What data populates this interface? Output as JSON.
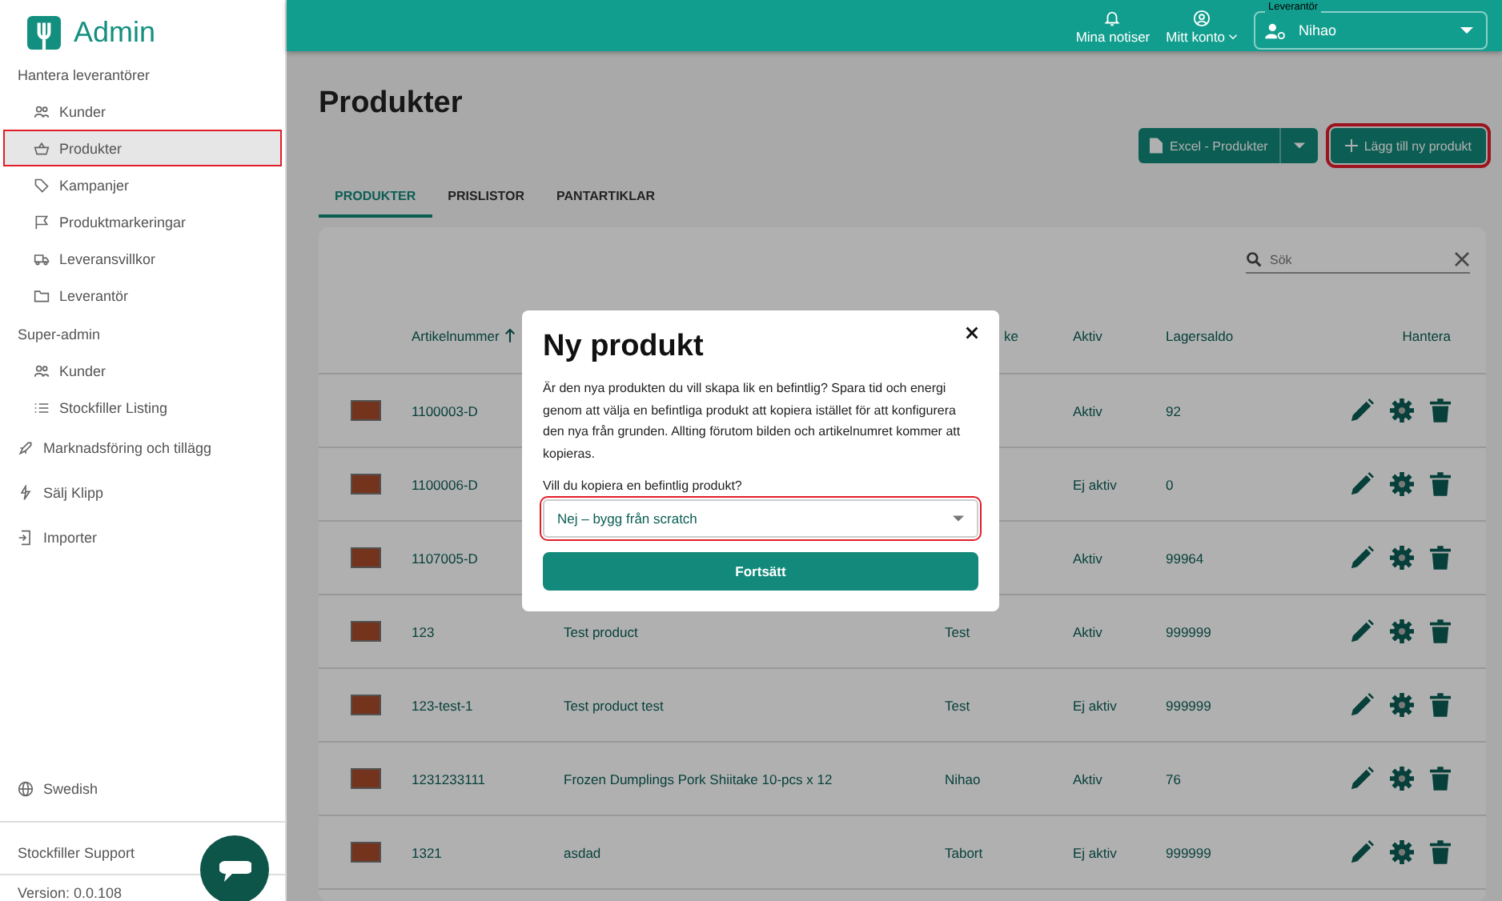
{
  "sidebar": {
    "logo": "Admin",
    "sections": [
      {
        "title": "Hantera leverantörer",
        "items": [
          {
            "label": "Kunder",
            "selected": false,
            "highlighted": false
          },
          {
            "label": "Produkter",
            "selected": true,
            "highlighted": true
          },
          {
            "label": "Kampanjer",
            "selected": false,
            "highlighted": false
          },
          {
            "label": "Produktmarkeringar",
            "selected": false,
            "highlighted": false
          },
          {
            "label": "Leveransvillkor",
            "selected": false,
            "highlighted": false
          },
          {
            "label": "Leverantör",
            "selected": false,
            "highlighted": false
          }
        ]
      },
      {
        "title": "Super-admin",
        "items": [
          {
            "label": "Kunder",
            "selected": false,
            "highlighted": false
          },
          {
            "label": "Stockfiller Listing",
            "selected": false,
            "highlighted": false
          }
        ]
      }
    ],
    "links": [
      "Marknadsföring och tillägg",
      "Sälj Klipp",
      "Importer"
    ],
    "language": "Swedish",
    "support": "Stockfiller Support",
    "version": "Version: 0.0.108"
  },
  "topbar": {
    "notifications": "Mina notiser",
    "account": "Mitt konto",
    "supplier": {
      "label": "Leverantör",
      "value": "Nihao"
    }
  },
  "page": {
    "title": "Produkter",
    "export_button": "Excel - Produkter",
    "add_button": {
      "label": "Lägg till ny produkt",
      "highlighted": true
    },
    "tabs": [
      {
        "label": "PRODUKTER",
        "selected": true
      },
      {
        "label": "PRISLISTOR",
        "selected": false
      },
      {
        "label": "PANTARTIKLAR",
        "selected": false
      }
    ]
  },
  "table": {
    "search": {
      "placeholder": "Sök"
    },
    "columns": {
      "column_1": "Artikelnummer",
      "column_3": "ke",
      "column_4": "Aktiv",
      "column_5": "Lagersaldo",
      "column_6": "Hantera"
    },
    "rows": [
      {
        "article": "1100003-D",
        "active": "Aktiv",
        "stock": "92"
      },
      {
        "article": "1100006-D",
        "active": "Ej aktiv",
        "stock": "0"
      },
      {
        "article": "1107005-D",
        "active": "Aktiv",
        "stock": "99964"
      },
      {
        "article": "123",
        "name": "Test product",
        "brand": "Test",
        "active": "Aktiv",
        "stock": "999999"
      },
      {
        "article": "123-test-1",
        "name": "Test product test",
        "brand": "Test",
        "active": "Ej aktiv",
        "stock": "999999"
      },
      {
        "article": "1231233111",
        "name": "Frozen Dumplings Pork Shiitake 10-pcs x 12",
        "brand": "Nihao",
        "active": "Aktiv",
        "stock": "76"
      },
      {
        "article": "1321",
        "name": "asdad",
        "brand": "Tabort",
        "active": "Ej aktiv",
        "stock": "999999"
      }
    ]
  },
  "modal": {
    "title": "Ny produkt",
    "text": "Är den nya produkten du vill skapa lik en befintlig? Spara tid och energi genom att välja en befintliga produkt att kopiera istället för att konfigurera den nya från grunden. Allting förutom bilden och artikelnumret kommer att kopieras.",
    "question": "Vill du kopiera en befintlig produkt?",
    "select": {
      "value": "Nej – bygg från scratch",
      "highlighted": true
    },
    "button": "Fortsätt"
  }
}
